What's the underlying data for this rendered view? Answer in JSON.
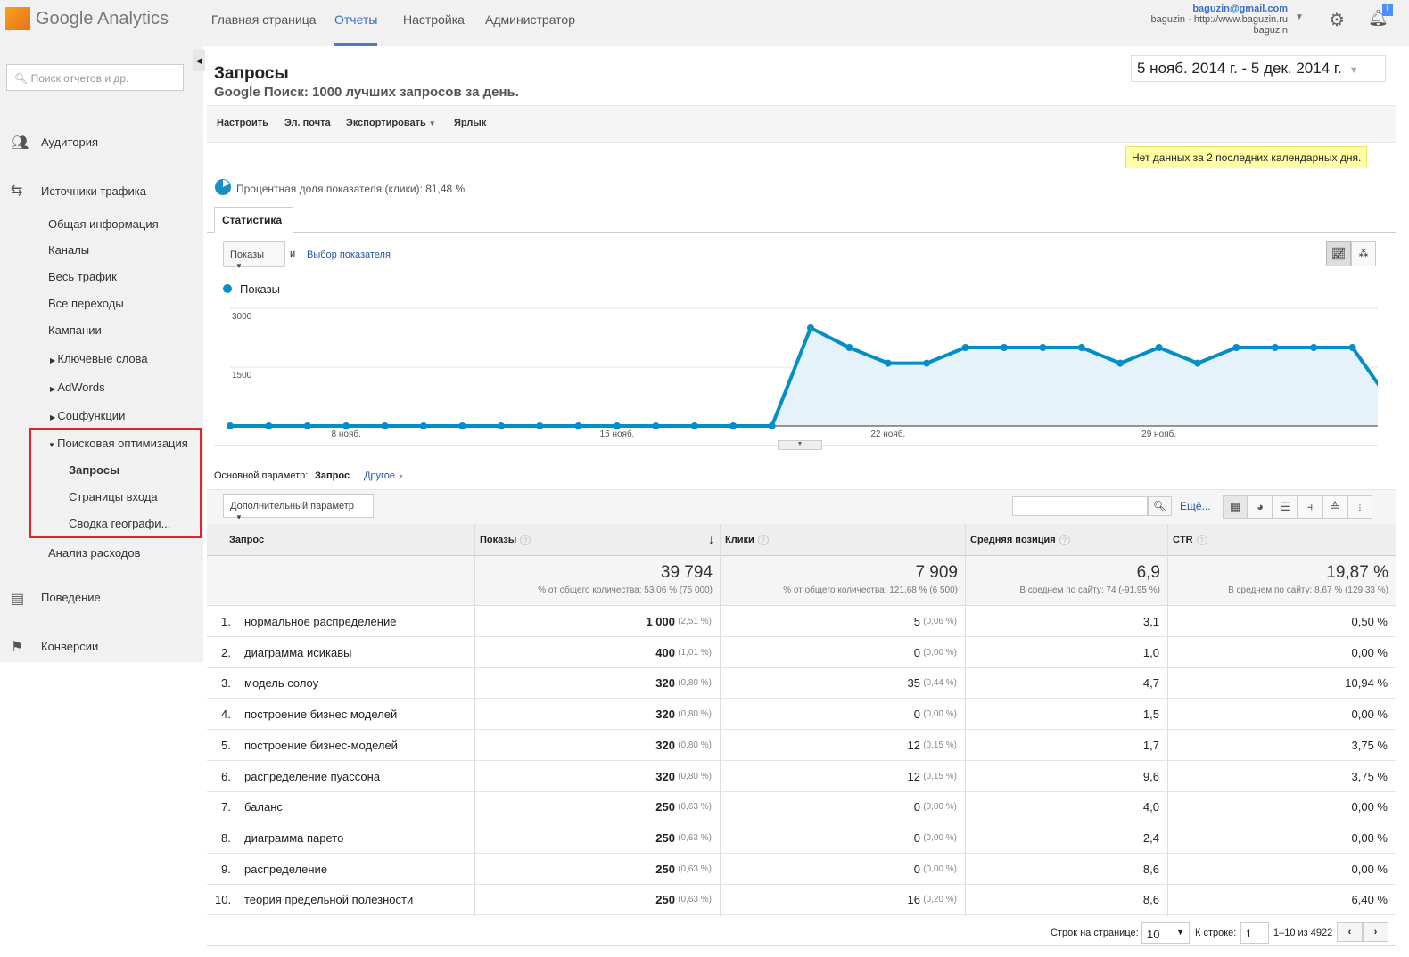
{
  "header": {
    "logo_text": "Google Analytics",
    "nav": [
      "Главная страница",
      "Отчеты",
      "Настройка",
      "Администратор"
    ],
    "active_nav": 1,
    "account_email": "baguzin@gmail.com",
    "account_property": "baguzin - http://www.baguzin.ru",
    "account_view": "baguzin",
    "notification_badge": "i"
  },
  "sidebar": {
    "search_placeholder": "Поиск отчетов и др.",
    "sections": [
      "Аудитория",
      "Источники трафика",
      "Поведение",
      "Конверсии"
    ],
    "traffic_items": [
      "Общая информация",
      "Каналы",
      "Весь трафик",
      "Все переходы",
      "Кампании"
    ],
    "collapsed_items": [
      "Ключевые слова",
      "AdWords",
      "Соцфункции"
    ],
    "seo_group": "Поисковая оптимизация",
    "seo_items": [
      "Запросы",
      "Страницы входа",
      "Сводка географи..."
    ],
    "cost_analysis": "Анализ расходов",
    "highlight_color": "#e0242b"
  },
  "report": {
    "title": "Запросы",
    "subtitle": "Google Поиск: 1000 лучших запросов за день.",
    "date_range": "5 нояб. 2014 г. - 5 дек. 2014 г.",
    "toolbar": [
      "Настроить",
      "Эл. почта",
      "Экспортировать",
      "Ярлык"
    ],
    "notice": "Нет данных за 2 последних календарных дня.",
    "sampling": "Процентная доля показателя (клики): 81,48 %",
    "tab": "Статистика",
    "metric_select": "Показы",
    "and": "и",
    "choose_metric": "Выбор показателя",
    "legend": "Показы"
  },
  "chart_data": {
    "type": "area",
    "series": [
      {
        "name": "Показы",
        "color": "#058dc7",
        "x": [
          "5 нояб.",
          "6 нояб.",
          "7 нояб.",
          "8 нояб.",
          "9 нояб.",
          "10 нояб.",
          "11 нояб.",
          "12 нояб.",
          "13 нояб.",
          "14 нояб.",
          "15 нояб.",
          "16 нояб.",
          "17 нояб.",
          "18 нояб.",
          "19 нояб.",
          "20 нояб.",
          "21 нояб.",
          "22 нояб.",
          "23 нояб.",
          "24 нояб.",
          "25 нояб.",
          "26 нояб.",
          "27 нояб.",
          "28 нояб.",
          "29 нояб.",
          "30 нояб.",
          "1 дек.",
          "2 дек.",
          "3 дек.",
          "4 дек.",
          "5 дек."
        ],
        "values": [
          0,
          0,
          0,
          0,
          0,
          0,
          0,
          0,
          0,
          0,
          0,
          0,
          0,
          0,
          0,
          2500,
          2000,
          1600,
          1600,
          2000,
          2000,
          2000,
          2000,
          1600,
          2000,
          1600,
          2000,
          2000,
          2000,
          2000,
          600
        ]
      }
    ],
    "yticks": [
      "3000",
      "1500"
    ],
    "ylim": [
      0,
      3000
    ],
    "xticks": [
      "8 нояб.",
      "15 нояб.",
      "22 нояб.",
      "29 нояб."
    ],
    "xtick_index": [
      3,
      10,
      17,
      24
    ],
    "grid": true
  },
  "table": {
    "primary_label": "Основной параметр:",
    "primary_value": "Запрос",
    "other": "Другое",
    "secondary": "Дополнительный параметр",
    "more": "Ещё...",
    "headers": [
      "Запрос",
      "Показы",
      "Клики",
      "Средняя позиция",
      "CTR"
    ],
    "totals": [
      {
        "value": "39 794",
        "note": "% от общего количества: 53,06 % (75 000)"
      },
      {
        "value": "7 909",
        "note": "% от общего количества: 121,68 % (6 500)"
      },
      {
        "value": "6,9",
        "note": "В среднем по сайту: 74 (-91,95 %)"
      },
      {
        "value": "19,87 %",
        "note": "В среднем по сайту: 8,67 % (129,33 %)"
      }
    ],
    "rows": [
      {
        "n": "1.",
        "q": "нормальное распределение",
        "imp": "1 000",
        "imp_p": "(2,51 %)",
        "clk": "5",
        "clk_p": "(0,06 %)",
        "pos": "3,1",
        "ctr": "0,50 %"
      },
      {
        "n": "2.",
        "q": "диаграмма исикавы",
        "imp": "400",
        "imp_p": "(1,01 %)",
        "clk": "0",
        "clk_p": "(0,00 %)",
        "pos": "1,0",
        "ctr": "0,00 %"
      },
      {
        "n": "3.",
        "q": "модель солоу",
        "imp": "320",
        "imp_p": "(0,80 %)",
        "clk": "35",
        "clk_p": "(0,44 %)",
        "pos": "4,7",
        "ctr": "10,94 %"
      },
      {
        "n": "4.",
        "q": "построение бизнес моделей",
        "imp": "320",
        "imp_p": "(0,80 %)",
        "clk": "0",
        "clk_p": "(0,00 %)",
        "pos": "1,5",
        "ctr": "0,00 %"
      },
      {
        "n": "5.",
        "q": "построение бизнес-моделей",
        "imp": "320",
        "imp_p": "(0,80 %)",
        "clk": "12",
        "clk_p": "(0,15 %)",
        "pos": "1,7",
        "ctr": "3,75 %"
      },
      {
        "n": "6.",
        "q": "распределение пуассона",
        "imp": "320",
        "imp_p": "(0,80 %)",
        "clk": "12",
        "clk_p": "(0,15 %)",
        "pos": "9,6",
        "ctr": "3,75 %"
      },
      {
        "n": "7.",
        "q": "баланс",
        "imp": "250",
        "imp_p": "(0,63 %)",
        "clk": "0",
        "clk_p": "(0,00 %)",
        "pos": "4,0",
        "ctr": "0,00 %"
      },
      {
        "n": "8.",
        "q": "диаграмма парето",
        "imp": "250",
        "imp_p": "(0,63 %)",
        "clk": "0",
        "clk_p": "(0,00 %)",
        "pos": "2,4",
        "ctr": "0,00 %"
      },
      {
        "n": "9.",
        "q": "распределение",
        "imp": "250",
        "imp_p": "(0,63 %)",
        "clk": "0",
        "clk_p": "(0,00 %)",
        "pos": "8,6",
        "ctr": "0,00 %"
      },
      {
        "n": "10.",
        "q": "теория предельной полезности",
        "imp": "250",
        "imp_p": "(0,63 %)",
        "clk": "16",
        "clk_p": "(0,20 %)",
        "pos": "8,6",
        "ctr": "6,40 %"
      }
    ],
    "pagination": {
      "rows_label": "Строк на странице:",
      "rows_value": "10",
      "goto_label": "К строке:",
      "goto_value": "1",
      "range": "1–10 из 4922"
    }
  }
}
